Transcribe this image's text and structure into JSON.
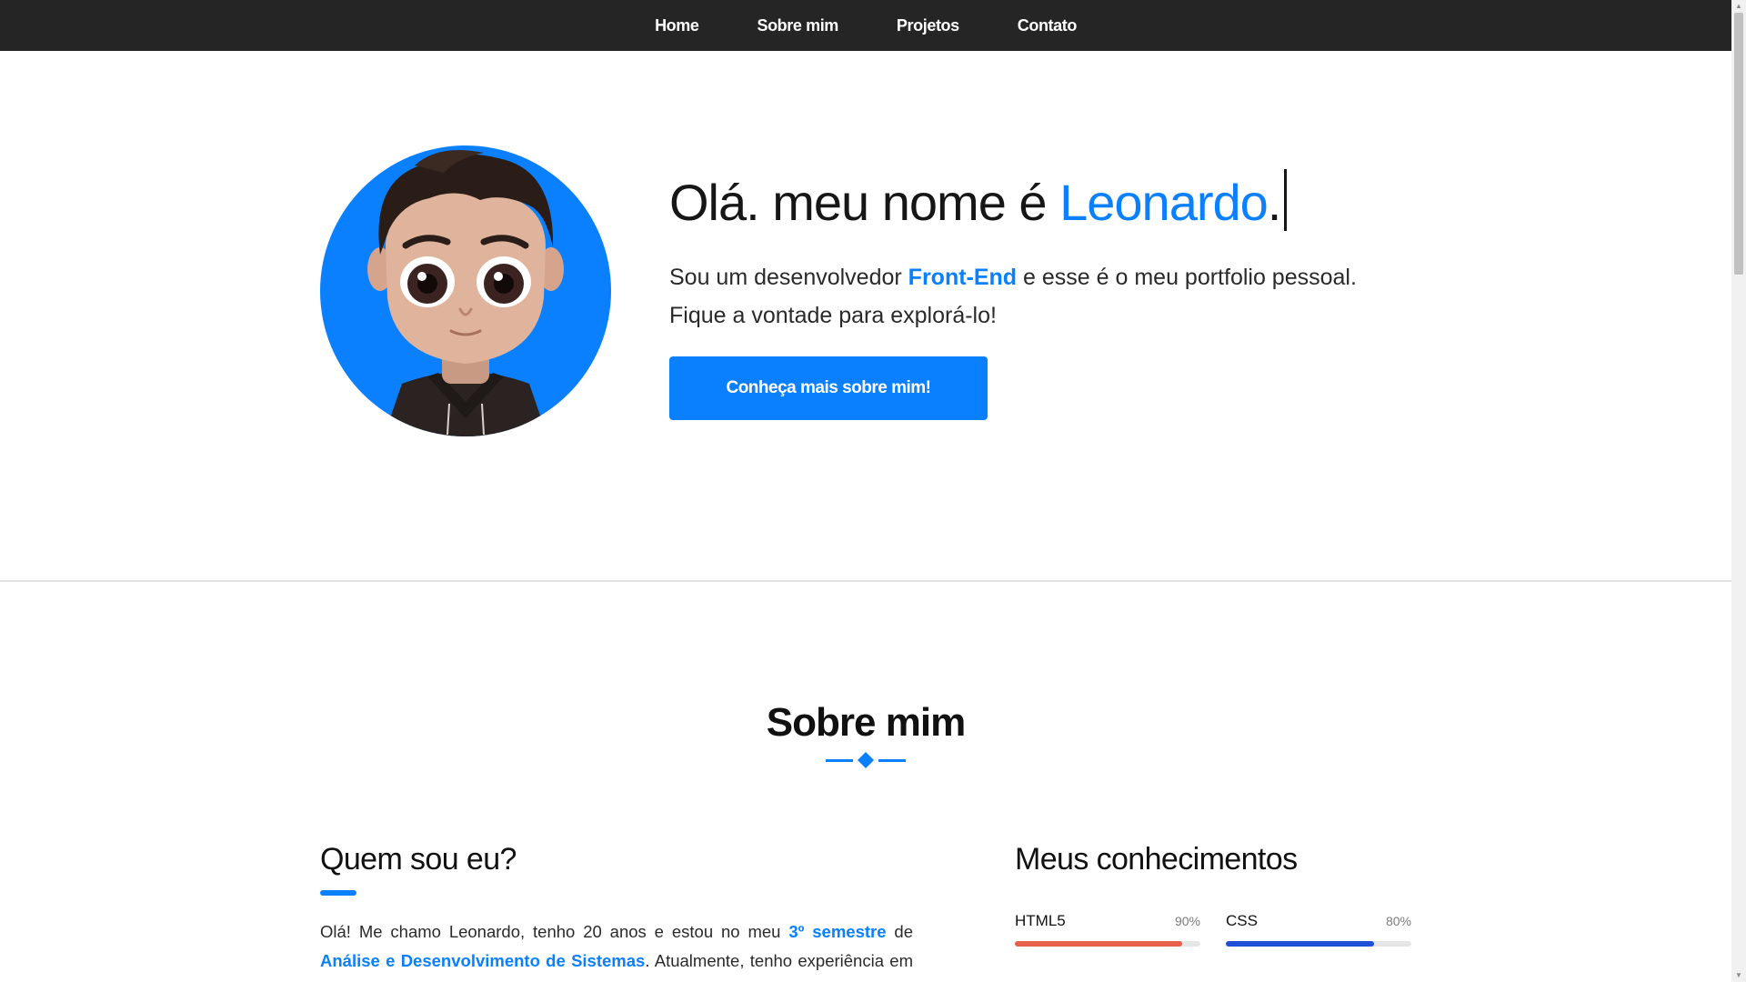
{
  "nav": {
    "items": [
      {
        "label": "Home"
      },
      {
        "label": "Sobre mim"
      },
      {
        "label": "Projetos"
      },
      {
        "label": "Contato"
      }
    ]
  },
  "hero": {
    "title_prefix": "Olá. meu nome é ",
    "title_name": "Leonardo",
    "title_suffix": ".",
    "desc_prefix": "Sou um desenvolvedor ",
    "desc_highlight": "Front-End",
    "desc_suffix": " e esse é o meu portfolio pessoal. Fique a vontade para explorá-lo!",
    "cta_label": "Conheça mais sobre mim!"
  },
  "about": {
    "title": "Sobre mim",
    "who_title": "Quem sou eu?",
    "text_1": "Olá! Me chamo Leonardo, tenho 20 anos e estou no meu ",
    "highlight_1": "3º semestre",
    "text_2": " de ",
    "highlight_2": "Análise e Desenvolvimento de Sistemas",
    "text_3": ". Atualmente, tenho experiência em projetos acadêmicos e pessoais, onde pude aplicar meus conhecimentos em"
  },
  "skills": {
    "title": "Meus conhecimentos",
    "items": [
      {
        "name": "HTML5",
        "percent_label": "90%",
        "level": 0.9,
        "color": "#e8604c"
      },
      {
        "name": "CSS",
        "percent_label": "80%",
        "level": 0.8,
        "color": "#1e4fd6"
      }
    ]
  },
  "colors": {
    "accent": "#0a80ff",
    "navbar": "#252525"
  },
  "icons": {
    "divider": "diamond-divider-icon",
    "avatar": "cartoon-avatar"
  }
}
